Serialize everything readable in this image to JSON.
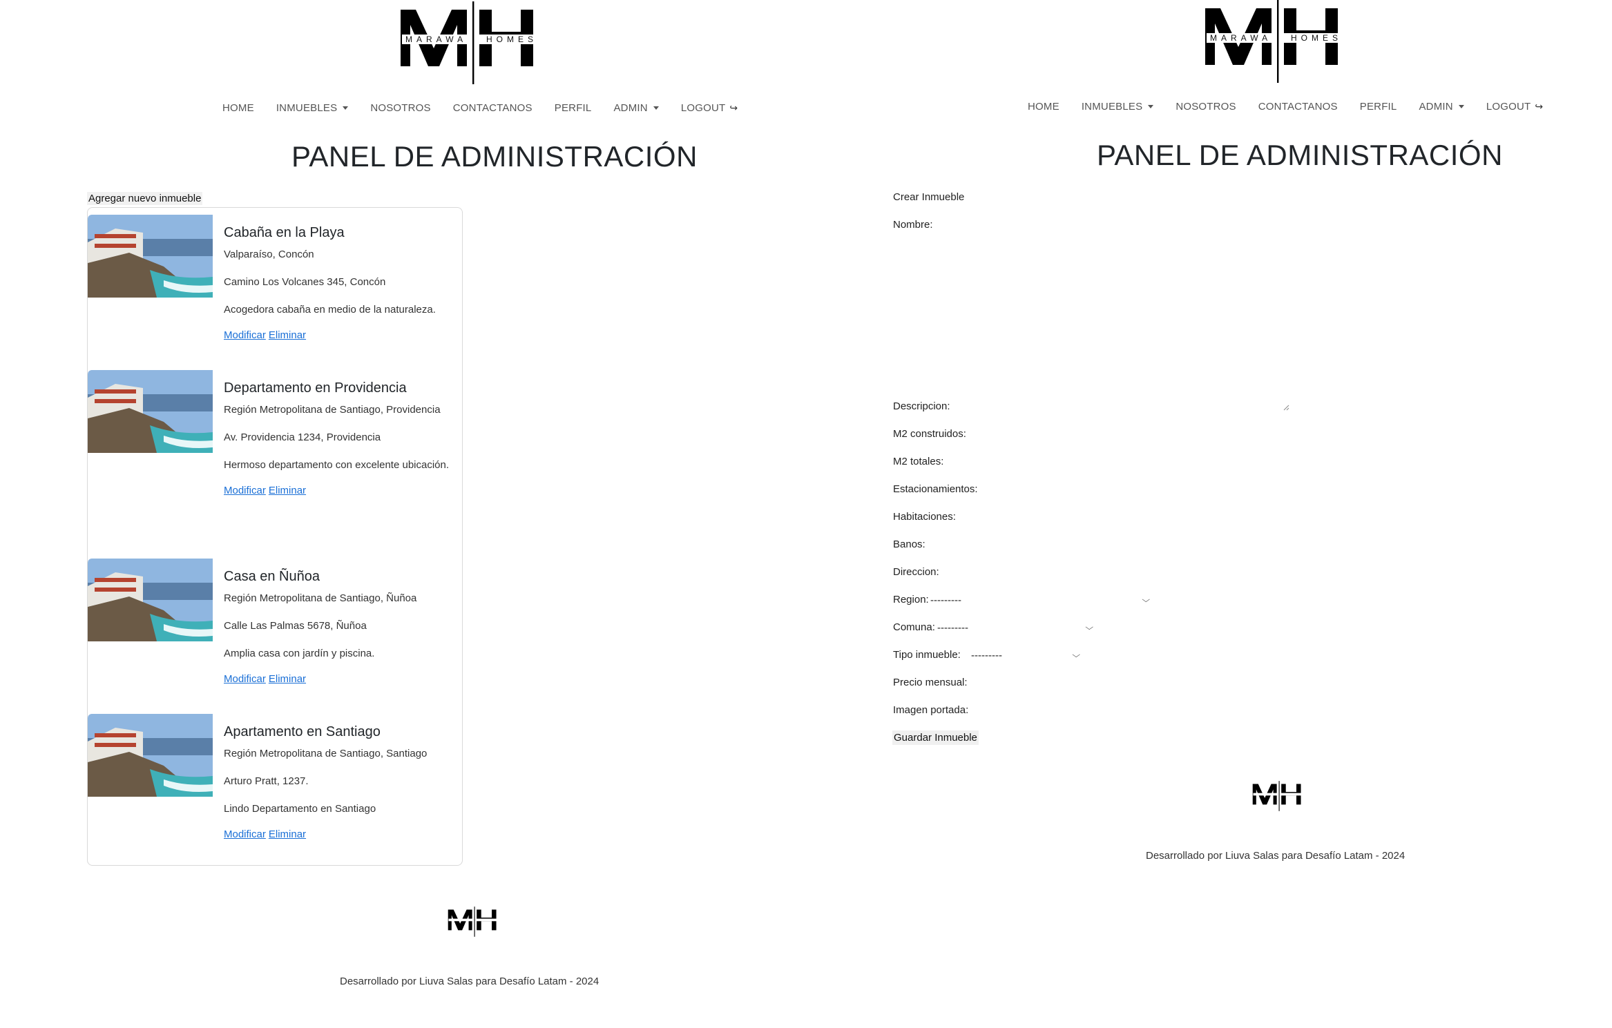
{
  "brand": {
    "letters": "MH",
    "wordmark_left": "MARAWA",
    "wordmark_right": "HOMES"
  },
  "nav": {
    "home": "HOME",
    "inmuebles": "INMUEBLES",
    "nosotros": "NOSOTROS",
    "contactanos": "CONTACTANOS",
    "perfil": "PERFIL",
    "admin": "ADMIN",
    "logout": "LOGOUT"
  },
  "page_title": "PANEL DE ADMINISTRACIÓN",
  "left": {
    "add_button": "Agregar nuevo inmueble",
    "properties": [
      {
        "title": "Cabaña en la Playa",
        "location": "Valparaíso, Concón",
        "address": "Camino Los Volcanes 345, Concón",
        "description": "Acogedora cabaña en medio de la naturaleza.",
        "edit": "Modificar",
        "delete": "Eliminar"
      },
      {
        "title": "Departamento en Providencia",
        "location": "Región Metropolitana de Santiago, Providencia",
        "address": "Av. Providencia 1234, Providencia",
        "description": "Hermoso departamento con excelente ubicación.",
        "edit": "Modificar",
        "delete": "Eliminar"
      },
      {
        "title": "Casa en Ñuñoa",
        "location": "Región Metropolitana de Santiago, Ñuñoa",
        "address": "Calle Las Palmas 5678, Ñuñoa",
        "description": "Amplia casa con jardín y piscina.",
        "edit": "Modificar",
        "delete": "Eliminar"
      },
      {
        "title": "Apartamento en Santiago",
        "location": "Región Metropolitana de Santiago, Santiago",
        "address": "Arturo Pratt, 1237.",
        "description": "Lindo Departamento en Santiago",
        "edit": "Modificar",
        "delete": "Eliminar"
      }
    ]
  },
  "right": {
    "form_title": "Crear Inmueble",
    "labels": {
      "nombre": "Nombre:",
      "descripcion": "Descripcion:",
      "m2_construidos": "M2 construidos:",
      "m2_totales": "M2 totales:",
      "estacionamientos": "Estacionamientos:",
      "habitaciones": "Habitaciones:",
      "banos": "Banos:",
      "direccion": "Direccion:",
      "region": "Region:",
      "comuna": "Comuna:",
      "tipo_inmueble": "Tipo inmueble:",
      "precio_mensual": "Precio mensual:",
      "imagen_portada": "Imagen portada:"
    },
    "selects": {
      "region": "---------",
      "comuna": "---------",
      "tipo_inmueble": "---------"
    },
    "save_button": "Guardar Inmueble"
  },
  "footer": {
    "text": "Desarrollado por Liuva Salas para Desafío Latam - 2024"
  }
}
